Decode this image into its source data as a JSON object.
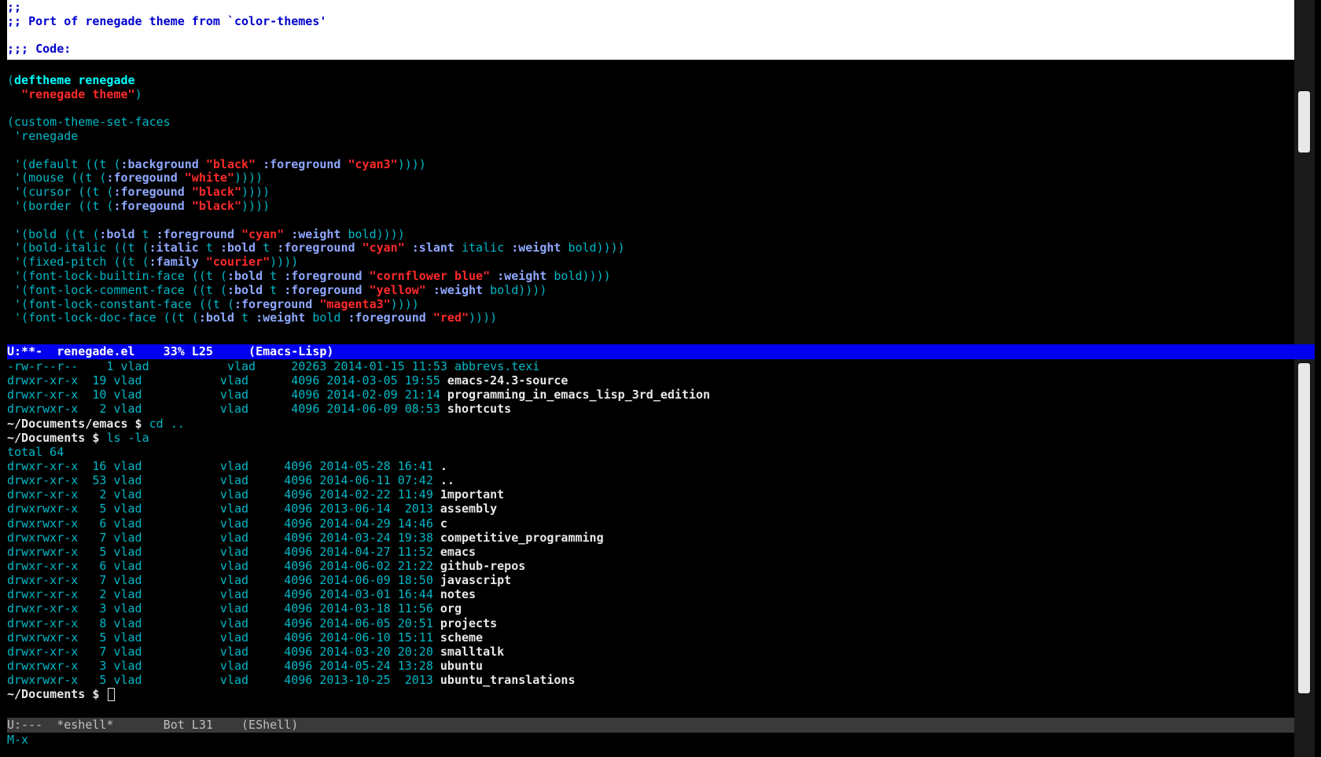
{
  "editor": {
    "header_comments": [
      ";;",
      ";; Port of renegade theme from `color-themes'",
      "",
      ";;; Code:"
    ],
    "code_lines": [
      [],
      [
        {
          "t": "(",
          "c": "c-code"
        },
        {
          "t": "deftheme",
          "c": "c-kw"
        },
        {
          "t": " ",
          "c": "c-code"
        },
        {
          "t": "renegade",
          "c": "c-kw"
        }
      ],
      [
        {
          "t": "  ",
          "c": "c-code"
        },
        {
          "t": "\"renegade theme\"",
          "c": "c-str"
        },
        {
          "t": ")",
          "c": "c-code"
        }
      ],
      [],
      [
        {
          "t": "(custom-theme-set-faces",
          "c": "c-code"
        }
      ],
      [
        {
          "t": " 'renegade",
          "c": "c-code"
        }
      ],
      [],
      [
        {
          "t": " '(default ((t (",
          "c": "c-code"
        },
        {
          "t": ":background",
          "c": "c-keyw"
        },
        {
          "t": " ",
          "c": "c-code"
        },
        {
          "t": "\"black\"",
          "c": "c-str"
        },
        {
          "t": " ",
          "c": "c-code"
        },
        {
          "t": ":foreground",
          "c": "c-keyw"
        },
        {
          "t": " ",
          "c": "c-code"
        },
        {
          "t": "\"cyan3\"",
          "c": "c-str"
        },
        {
          "t": "))))",
          "c": "c-code"
        }
      ],
      [
        {
          "t": " '(mouse ((t (",
          "c": "c-code"
        },
        {
          "t": ":foregound",
          "c": "c-keyw"
        },
        {
          "t": " ",
          "c": "c-code"
        },
        {
          "t": "\"white\"",
          "c": "c-str"
        },
        {
          "t": "))))",
          "c": "c-code"
        }
      ],
      [
        {
          "t": " '(cursor ((t (",
          "c": "c-code"
        },
        {
          "t": ":foregound",
          "c": "c-keyw"
        },
        {
          "t": " ",
          "c": "c-code"
        },
        {
          "t": "\"black\"",
          "c": "c-str"
        },
        {
          "t": "))))",
          "c": "c-code"
        }
      ],
      [
        {
          "t": " '(border ((t (",
          "c": "c-code"
        },
        {
          "t": ":foregound",
          "c": "c-keyw"
        },
        {
          "t": " ",
          "c": "c-code"
        },
        {
          "t": "\"black\"",
          "c": "c-str"
        },
        {
          "t": "))))",
          "c": "c-code"
        }
      ],
      [],
      [
        {
          "t": " '(bold ((t (",
          "c": "c-code"
        },
        {
          "t": ":bold",
          "c": "c-keyw"
        },
        {
          "t": " t ",
          "c": "c-code"
        },
        {
          "t": ":foreground",
          "c": "c-keyw"
        },
        {
          "t": " ",
          "c": "c-code"
        },
        {
          "t": "\"cyan\"",
          "c": "c-str"
        },
        {
          "t": " ",
          "c": "c-code"
        },
        {
          "t": ":weight",
          "c": "c-keyw"
        },
        {
          "t": " bold))))",
          "c": "c-code"
        }
      ],
      [
        {
          "t": " '(bold-italic ((t (",
          "c": "c-code"
        },
        {
          "t": ":italic",
          "c": "c-keyw"
        },
        {
          "t": " t ",
          "c": "c-code"
        },
        {
          "t": ":bold",
          "c": "c-keyw"
        },
        {
          "t": " t ",
          "c": "c-code"
        },
        {
          "t": ":foreground",
          "c": "c-keyw"
        },
        {
          "t": " ",
          "c": "c-code"
        },
        {
          "t": "\"cyan\"",
          "c": "c-str"
        },
        {
          "t": " ",
          "c": "c-code"
        },
        {
          "t": ":slant",
          "c": "c-keyw"
        },
        {
          "t": " italic ",
          "c": "c-code"
        },
        {
          "t": ":weight",
          "c": "c-keyw"
        },
        {
          "t": " bold))))",
          "c": "c-code"
        }
      ],
      [
        {
          "t": " '(fixed-pitch ((t (",
          "c": "c-code"
        },
        {
          "t": ":family",
          "c": "c-keyw"
        },
        {
          "t": " ",
          "c": "c-code"
        },
        {
          "t": "\"courier\"",
          "c": "c-str"
        },
        {
          "t": "))))",
          "c": "c-code"
        }
      ],
      [
        {
          "t": " '(font-lock-builtin-face ((t (",
          "c": "c-code"
        },
        {
          "t": ":bold",
          "c": "c-keyw"
        },
        {
          "t": " t ",
          "c": "c-code"
        },
        {
          "t": ":foreground",
          "c": "c-keyw"
        },
        {
          "t": " ",
          "c": "c-code"
        },
        {
          "t": "\"cornflower blue\"",
          "c": "c-str"
        },
        {
          "t": " ",
          "c": "c-code"
        },
        {
          "t": ":weight",
          "c": "c-keyw"
        },
        {
          "t": " bold))))",
          "c": "c-code"
        }
      ],
      [
        {
          "t": " '(font-lock-comment-face ((t (",
          "c": "c-code"
        },
        {
          "t": ":bold",
          "c": "c-keyw"
        },
        {
          "t": " t ",
          "c": "c-code"
        },
        {
          "t": ":foreground",
          "c": "c-keyw"
        },
        {
          "t": " ",
          "c": "c-code"
        },
        {
          "t": "\"yellow\"",
          "c": "c-str"
        },
        {
          "t": " ",
          "c": "c-code"
        },
        {
          "t": ":weight",
          "c": "c-keyw"
        },
        {
          "t": " bold))))",
          "c": "c-code"
        }
      ],
      [
        {
          "t": " '(font-lock-constant-face ((t (",
          "c": "c-code"
        },
        {
          "t": ":foreground",
          "c": "c-keyw"
        },
        {
          "t": " ",
          "c": "c-code"
        },
        {
          "t": "\"magenta3\"",
          "c": "c-str"
        },
        {
          "t": "))))",
          "c": "c-code"
        }
      ],
      [
        {
          "t": " '(font-lock-doc-face ((t (",
          "c": "c-code"
        },
        {
          "t": ":bold",
          "c": "c-keyw"
        },
        {
          "t": " t ",
          "c": "c-code"
        },
        {
          "t": ":weight",
          "c": "c-keyw"
        },
        {
          "t": " bold ",
          "c": "c-code"
        },
        {
          "t": ":foreground",
          "c": "c-keyw"
        },
        {
          "t": " ",
          "c": "c-code"
        },
        {
          "t": "\"red\"",
          "c": "c-str"
        },
        {
          "t": "))))",
          "c": "c-code"
        }
      ]
    ],
    "modeline": "U:**-  renegade.el    33% L25     (Emacs-Lisp)"
  },
  "eshell": {
    "lines": [
      [
        {
          "t": "-rw-r--r--    1 vlad           vlad     20263 2014-01-15 11:53 ",
          "c": "c-plain"
        },
        {
          "t": "abbrevs.texi",
          "c": "c-plain"
        }
      ],
      [
        {
          "t": "drwxr-xr-x  19 vlad           vlad      4096 2014-03-05 19:55 ",
          "c": "c-plain"
        },
        {
          "t": "emacs-24.3-source",
          "c": "c-dir"
        }
      ],
      [
        {
          "t": "drwxr-xr-x  10 vlad           vlad      4096 2014-02-09 21:14 ",
          "c": "c-plain"
        },
        {
          "t": "programming_in_emacs_lisp_3rd_edition",
          "c": "c-dir"
        }
      ],
      [
        {
          "t": "drwxrwxr-x   2 vlad           vlad      4096 2014-06-09 08:53 ",
          "c": "c-plain"
        },
        {
          "t": "shortcuts",
          "c": "c-dir"
        }
      ],
      [
        {
          "t": "~/Documents/emacs $ ",
          "c": "c-prompt"
        },
        {
          "t": "cd ..",
          "c": "c-plain"
        }
      ],
      [
        {
          "t": "~/Documents $ ",
          "c": "c-prompt"
        },
        {
          "t": "ls -la",
          "c": "c-plain"
        }
      ],
      [
        {
          "t": "total 64",
          "c": "c-plain"
        }
      ],
      [
        {
          "t": "drwxr-xr-x  16 vlad           vlad     4096 2014-05-28 16:41 ",
          "c": "c-plain"
        },
        {
          "t": ".",
          "c": "c-dir"
        }
      ],
      [
        {
          "t": "drwxr-xr-x  53 vlad           vlad     4096 2014-06-11 07:42 ",
          "c": "c-plain"
        },
        {
          "t": "..",
          "c": "c-dir"
        }
      ],
      [
        {
          "t": "drwxr-xr-x   2 vlad           vlad     4096 2014-02-22 11:49 ",
          "c": "c-plain"
        },
        {
          "t": "1mportant",
          "c": "c-dir"
        }
      ],
      [
        {
          "t": "drwxrwxr-x   5 vlad           vlad     4096 2013-06-14  2013 ",
          "c": "c-plain"
        },
        {
          "t": "assembly",
          "c": "c-dir"
        }
      ],
      [
        {
          "t": "drwxrwxr-x   6 vlad           vlad     4096 2014-04-29 14:46 ",
          "c": "c-plain"
        },
        {
          "t": "c",
          "c": "c-dir"
        }
      ],
      [
        {
          "t": "drwxrwxr-x   7 vlad           vlad     4096 2014-03-24 19:38 ",
          "c": "c-plain"
        },
        {
          "t": "competitive_programming",
          "c": "c-dir"
        }
      ],
      [
        {
          "t": "drwxrwxr-x   5 vlad           vlad     4096 2014-04-27 11:52 ",
          "c": "c-plain"
        },
        {
          "t": "emacs",
          "c": "c-dir"
        }
      ],
      [
        {
          "t": "drwxr-xr-x   6 vlad           vlad     4096 2014-06-02 21:22 ",
          "c": "c-plain"
        },
        {
          "t": "github-repos",
          "c": "c-dir"
        }
      ],
      [
        {
          "t": "drwxr-xr-x   7 vlad           vlad     4096 2014-06-09 18:50 ",
          "c": "c-plain"
        },
        {
          "t": "javascript",
          "c": "c-dir"
        }
      ],
      [
        {
          "t": "drwxr-xr-x   2 vlad           vlad     4096 2014-03-01 16:44 ",
          "c": "c-plain"
        },
        {
          "t": "notes",
          "c": "c-dir"
        }
      ],
      [
        {
          "t": "drwxr-xr-x   3 vlad           vlad     4096 2014-03-18 11:56 ",
          "c": "c-plain"
        },
        {
          "t": "org",
          "c": "c-dir"
        }
      ],
      [
        {
          "t": "drwxr-xr-x   8 vlad           vlad     4096 2014-06-05 20:51 ",
          "c": "c-plain"
        },
        {
          "t": "projects",
          "c": "c-dir"
        }
      ],
      [
        {
          "t": "drwxrwxr-x   5 vlad           vlad     4096 2014-06-10 15:11 ",
          "c": "c-plain"
        },
        {
          "t": "scheme",
          "c": "c-dir"
        }
      ],
      [
        {
          "t": "drwxr-xr-x   7 vlad           vlad     4096 2014-03-20 20:20 ",
          "c": "c-plain"
        },
        {
          "t": "smalltalk",
          "c": "c-dir"
        }
      ],
      [
        {
          "t": "drwxrwxr-x   3 vlad           vlad     4096 2014-05-24 13:28 ",
          "c": "c-plain"
        },
        {
          "t": "ubuntu",
          "c": "c-dir"
        }
      ],
      [
        {
          "t": "drwxrwxr-x   5 vlad           vlad     4096 2013-10-25  2013 ",
          "c": "c-plain"
        },
        {
          "t": "ubuntu_translations",
          "c": "c-dir"
        }
      ]
    ],
    "prompt": "~/Documents $ ",
    "input_value": "",
    "modeline": "U:---  *eshell*       Bot L31    (EShell)"
  },
  "minibuffer": {
    "text": "M-x"
  },
  "colors": {
    "background": "#000000",
    "code_cyan": "#00b8c8",
    "string_red": "#ff2a2a",
    "comment_blue": "#0000cc",
    "active_modeline": "#0000ee",
    "inactive_modeline": "#3a3a3a"
  }
}
